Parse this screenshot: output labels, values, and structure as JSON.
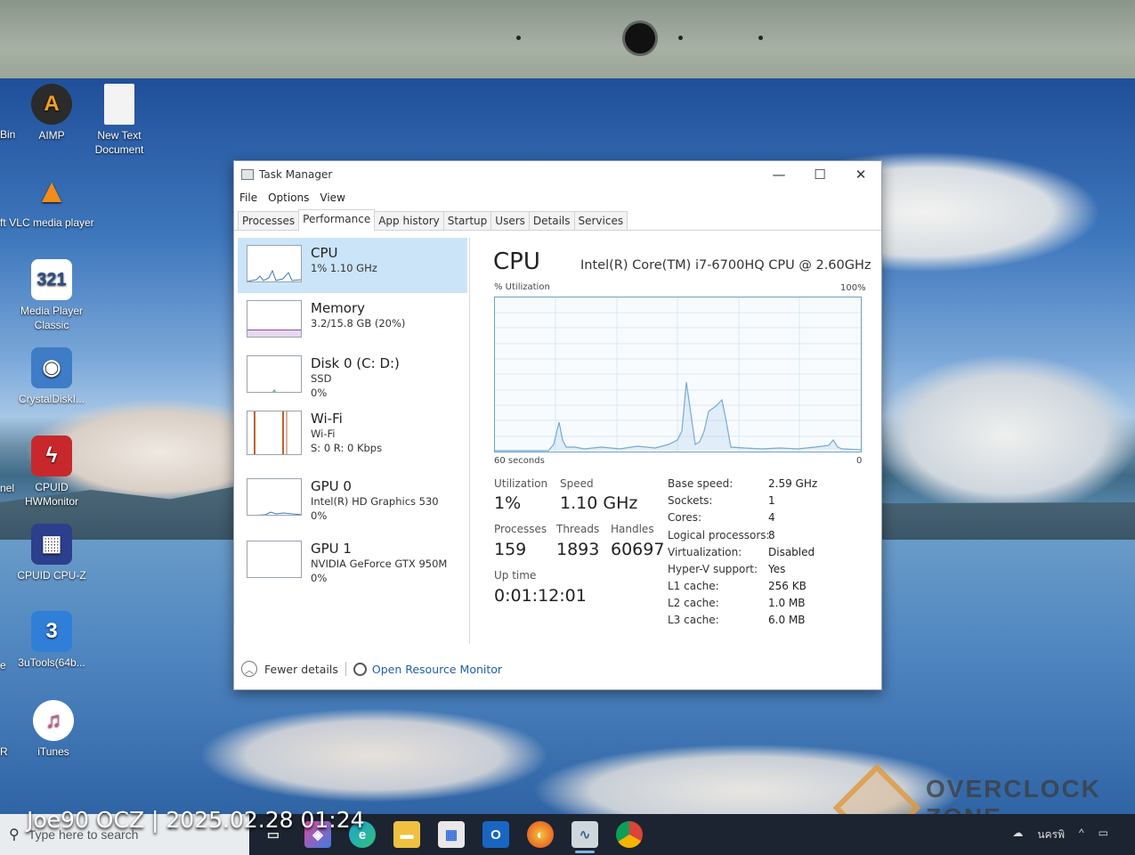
{
  "desktop": {
    "icons": [
      {
        "label": "AIMP",
        "icon": "aimp-icon"
      },
      {
        "label": "New Text Document",
        "icon": "text-document-icon"
      },
      {
        "label": "VLC media player",
        "icon": "vlc-icon"
      },
      {
        "label": "Media Player Classic",
        "icon": "media-player-classic-icon"
      },
      {
        "label": "CrystalDiskI...",
        "icon": "crystaldisk-icon"
      },
      {
        "label": "CPUID HWMonitor",
        "icon": "hwmonitor-icon"
      },
      {
        "label": "CPUID CPU-Z",
        "icon": "cpuz-icon"
      },
      {
        "label": "3uTools(64b...",
        "icon": "3utools-icon"
      },
      {
        "label": "iTunes",
        "icon": "itunes-icon"
      }
    ],
    "partial_labels": [
      "Bin",
      "ft",
      "nel",
      "e",
      "R"
    ]
  },
  "task_manager": {
    "title": "Task Manager",
    "menu": [
      "File",
      "Options",
      "View"
    ],
    "tabs": [
      "Processes",
      "Performance",
      "App history",
      "Startup",
      "Users",
      "Details",
      "Services"
    ],
    "active_tab": "Performance",
    "resources": [
      {
        "name": "CPU",
        "sub1": "1%  1.10 GHz",
        "sub2": "",
        "sub3": ""
      },
      {
        "name": "Memory",
        "sub1": "3.2/15.8 GB (20%)",
        "sub2": "",
        "sub3": ""
      },
      {
        "name": "Disk 0 (C: D:)",
        "sub1": "SSD",
        "sub2": "0%",
        "sub3": ""
      },
      {
        "name": "Wi-Fi",
        "sub1": "Wi-Fi",
        "sub2": "S: 0  R: 0 Kbps",
        "sub3": ""
      },
      {
        "name": "GPU 0",
        "sub1": "Intel(R) HD Graphics 530",
        "sub2": "0%",
        "sub3": ""
      },
      {
        "name": "GPU 1",
        "sub1": "NVIDIA GeForce GTX 950M",
        "sub2": "0%",
        "sub3": ""
      }
    ],
    "cpu": {
      "heading": "CPU",
      "model": "Intel(R) Core(TM) i7-6700HQ CPU @ 2.60GHz",
      "util_label": "% Utilization",
      "max_label": "100%",
      "time_label": "60 seconds",
      "min_label": "0",
      "utilization_label": "Utilization",
      "utilization": "1%",
      "speed_label": "Speed",
      "speed": "1.10 GHz",
      "processes_label": "Processes",
      "processes": "159",
      "threads_label": "Threads",
      "threads": "1893",
      "handles_label": "Handles",
      "handles": "60697",
      "uptime_label": "Up time",
      "uptime": "0:01:12:01",
      "specs": [
        {
          "k": "Base speed:",
          "v": "2.59 GHz"
        },
        {
          "k": "Sockets:",
          "v": "1"
        },
        {
          "k": "Cores:",
          "v": "4"
        },
        {
          "k": "Logical processors:",
          "v": "8"
        },
        {
          "k": "Virtualization:",
          "v": "Disabled"
        },
        {
          "k": "Hyper-V support:",
          "v": "Yes"
        },
        {
          "k": "L1 cache:",
          "v": "256 KB"
        },
        {
          "k": "L2 cache:",
          "v": "1.0 MB"
        },
        {
          "k": "L3 cache:",
          "v": "6.0 MB"
        }
      ]
    },
    "footer": {
      "fewer": "Fewer details",
      "monitor": "Open Resource Monitor"
    }
  },
  "taskbar": {
    "search_placeholder": "Type here to search",
    "apps": [
      "task-view-icon",
      "copilot-icon",
      "edge-icon",
      "file-explorer-icon",
      "store-icon",
      "outlook-icon",
      "firefox-icon",
      "task-manager-icon",
      "chrome-icon"
    ],
    "tray_text": "นครพิ"
  },
  "overlay": {
    "caption": "Joe90 OCZ | 2025.02.28 01:24",
    "watermark": "OVERCLOCK ZONE"
  },
  "colors": {
    "accent": "#cce4f7",
    "graph_line": "#6e9fc6"
  }
}
